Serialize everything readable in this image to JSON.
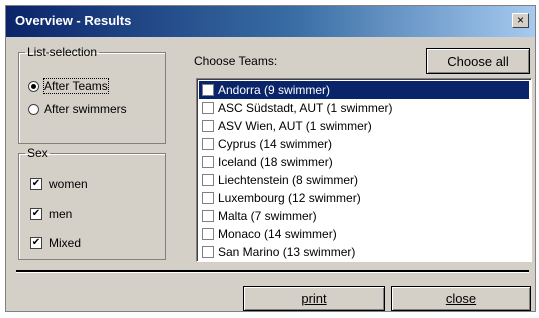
{
  "window": {
    "title": "Overview - Results",
    "close_glyph": "×"
  },
  "list_selection": {
    "legend": "List-selection",
    "options": [
      {
        "label": "After Teams",
        "checked": true
      },
      {
        "label": "After swimmers",
        "checked": false
      }
    ]
  },
  "sex": {
    "legend": "Sex",
    "options": [
      {
        "label": "women",
        "checked": true
      },
      {
        "label": "men",
        "checked": true
      },
      {
        "label": "Mixed",
        "checked": true
      }
    ],
    "check_glyph": "✔"
  },
  "teams": {
    "label": "Choose Teams:",
    "choose_all_label": "Choose all",
    "items": [
      {
        "label": "Andorra (9 swimmer)",
        "selected": true
      },
      {
        "label": "ASC Südstadt, AUT (1 swimmer)",
        "selected": false
      },
      {
        "label": "ASV Wien, AUT (1 swimmer)",
        "selected": false
      },
      {
        "label": "Cyprus (14 swimmer)",
        "selected": false
      },
      {
        "label": "Iceland (18 swimmer)",
        "selected": false
      },
      {
        "label": "Liechtenstein (8 swimmer)",
        "selected": false
      },
      {
        "label": "Luxembourg (12 swimmer)",
        "selected": false
      },
      {
        "label": "Malta (7 swimmer)",
        "selected": false
      },
      {
        "label": "Monaco (14 swimmer)",
        "selected": false
      },
      {
        "label": "San Marino (13 swimmer)",
        "selected": false
      }
    ]
  },
  "footer": {
    "print_label": "print",
    "close_label": "close"
  }
}
